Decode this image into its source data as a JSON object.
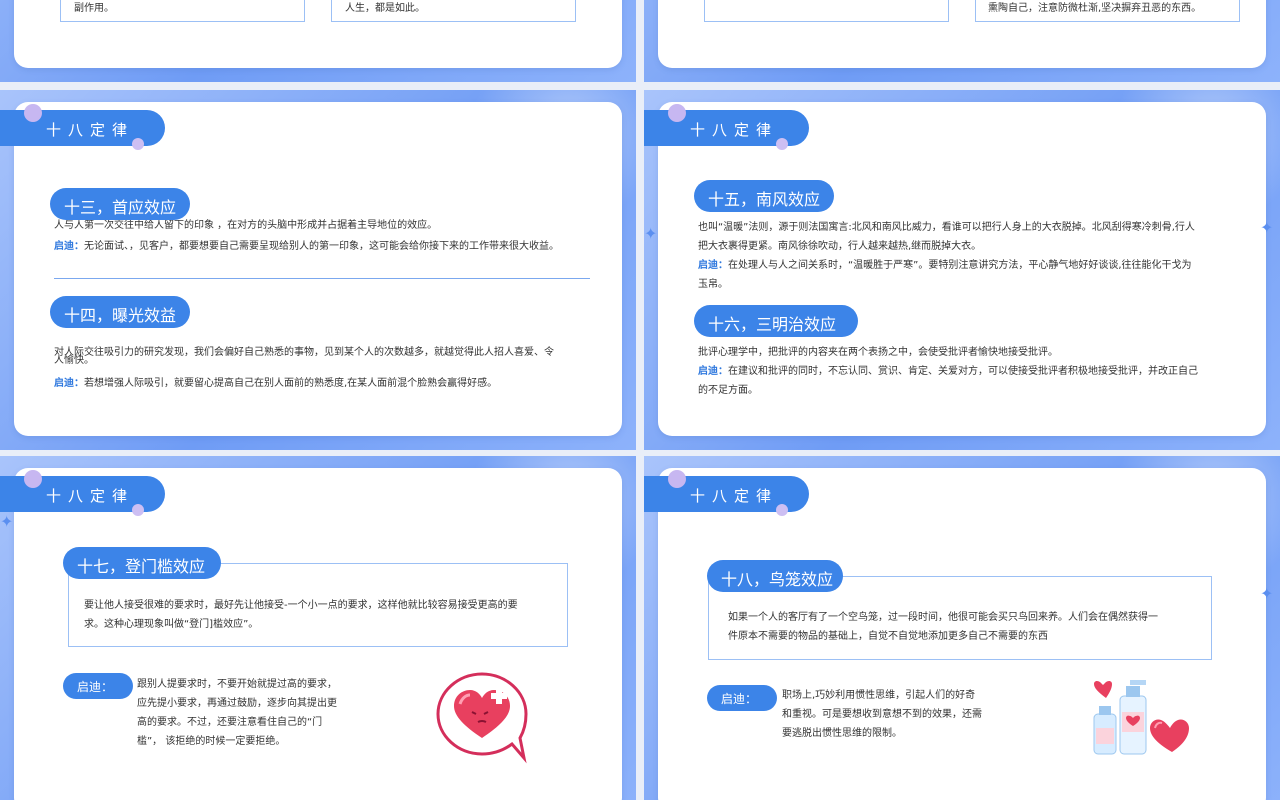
{
  "top_left": {
    "box1": "副作用。",
    "box2": "人生，都是如此。"
  },
  "top_right": {
    "box2": "熏陶自己，注意防微杜渐,坚决摒弃丑恶的东西。"
  },
  "header_title": "十八定律",
  "slide3": {
    "s1_title": "十三，首应效应",
    "s1_body": "人与人第一次交往中给人留下的印象 ，在对方的头脑中形成并占据着主导地位的效应。",
    "s1_key": "启迪：",
    "s1_key_text": "无论面试、，见客户，都要想要自己需要呈现给别人的第一印象，这可能会给你接下来的工作带来很大收益。",
    "s2_title": "十四，曝光效益",
    "s2_body_l1": "对人际交往吸引力的研究发现，我们会偏好自己熟悉的事物，见到某个人的次数越多，就越觉得此人招人喜爱、令",
    "s2_body_l2": "人愉快。",
    "s2_key": "启迪：",
    "s2_key_text": "若想增强人际吸引，就要留心提高自己在别人面前的熟悉度,在某人面前混个脸熟会赢得好感。"
  },
  "slide4": {
    "s1_title": "十五，南风效应",
    "s1_body_l1": "也叫“温暖”法则，源于则法国寓言:北风和南风比威力，看谁可以把行人身上的大衣脱掉。北风刮得寒冷刺骨,行人",
    "s1_body_l2": "把大衣裹得更紧。南风徐徐吹动，行人越来越热,继而脱掉大衣。",
    "s1_key": "启迪：",
    "s1_key_text_l1": "在处理人与人之间关系时，“温暖胜于严寒”。要特别注意讲究方法，平心静气地好好谈谈,往往能化干戈为",
    "s1_key_text_l2": "玉帛。",
    "s2_title": "十六，三明治效应",
    "s2_body": "批评心理学中，把批评的内容夹在两个表扬之中，会使受批评者愉快地接受批评。",
    "s2_key": "启迪：",
    "s2_key_text_l1": "在建议和批评的同时，不忘认同、赏识、肯定、关爱对方，可以使接受批评者积极地接受批评，并改正自己",
    "s2_key_text_l2": "的不足方面。"
  },
  "slide5": {
    "title": "十七，登门槛效应",
    "body_l1": "要让他人接受很难的要求时，最好先让他接受-一个小一点的要求，这样他就比较容易接受更高的要",
    "body_l2": "求。这种心理现象叫做“登门]槛效应”。",
    "key": "启迪：",
    "key_l1": "跟别人提要求时，不要开始就提过高的要求，",
    "key_l2": "应先提小要求，再通过鼓励，逐步向其提出更",
    "key_l3": "高的要求。不过，还要注意看住自己的“门",
    "key_l4": "槛”， 该拒绝的时候一定要拒绝。"
  },
  "slide6": {
    "title": "十八，鸟笼效应",
    "body_l1": "如果一个人的客厅有了一个空鸟笼，过一段时间，他很可能会买只鸟回来养。人们会在偶然获得一",
    "body_l2": "件原本不需要的物品的基础上，自觉不自觉地添加更多自己不需要的东西",
    "key": "启迪：",
    "key_l1": "职场上,巧妙利用惯性思维，引起人们的好奇",
    "key_l2": "和重视。可是要想收到意想不到的效果，还需",
    "key_l3": "要逃脱出惯性思维的限制。"
  }
}
